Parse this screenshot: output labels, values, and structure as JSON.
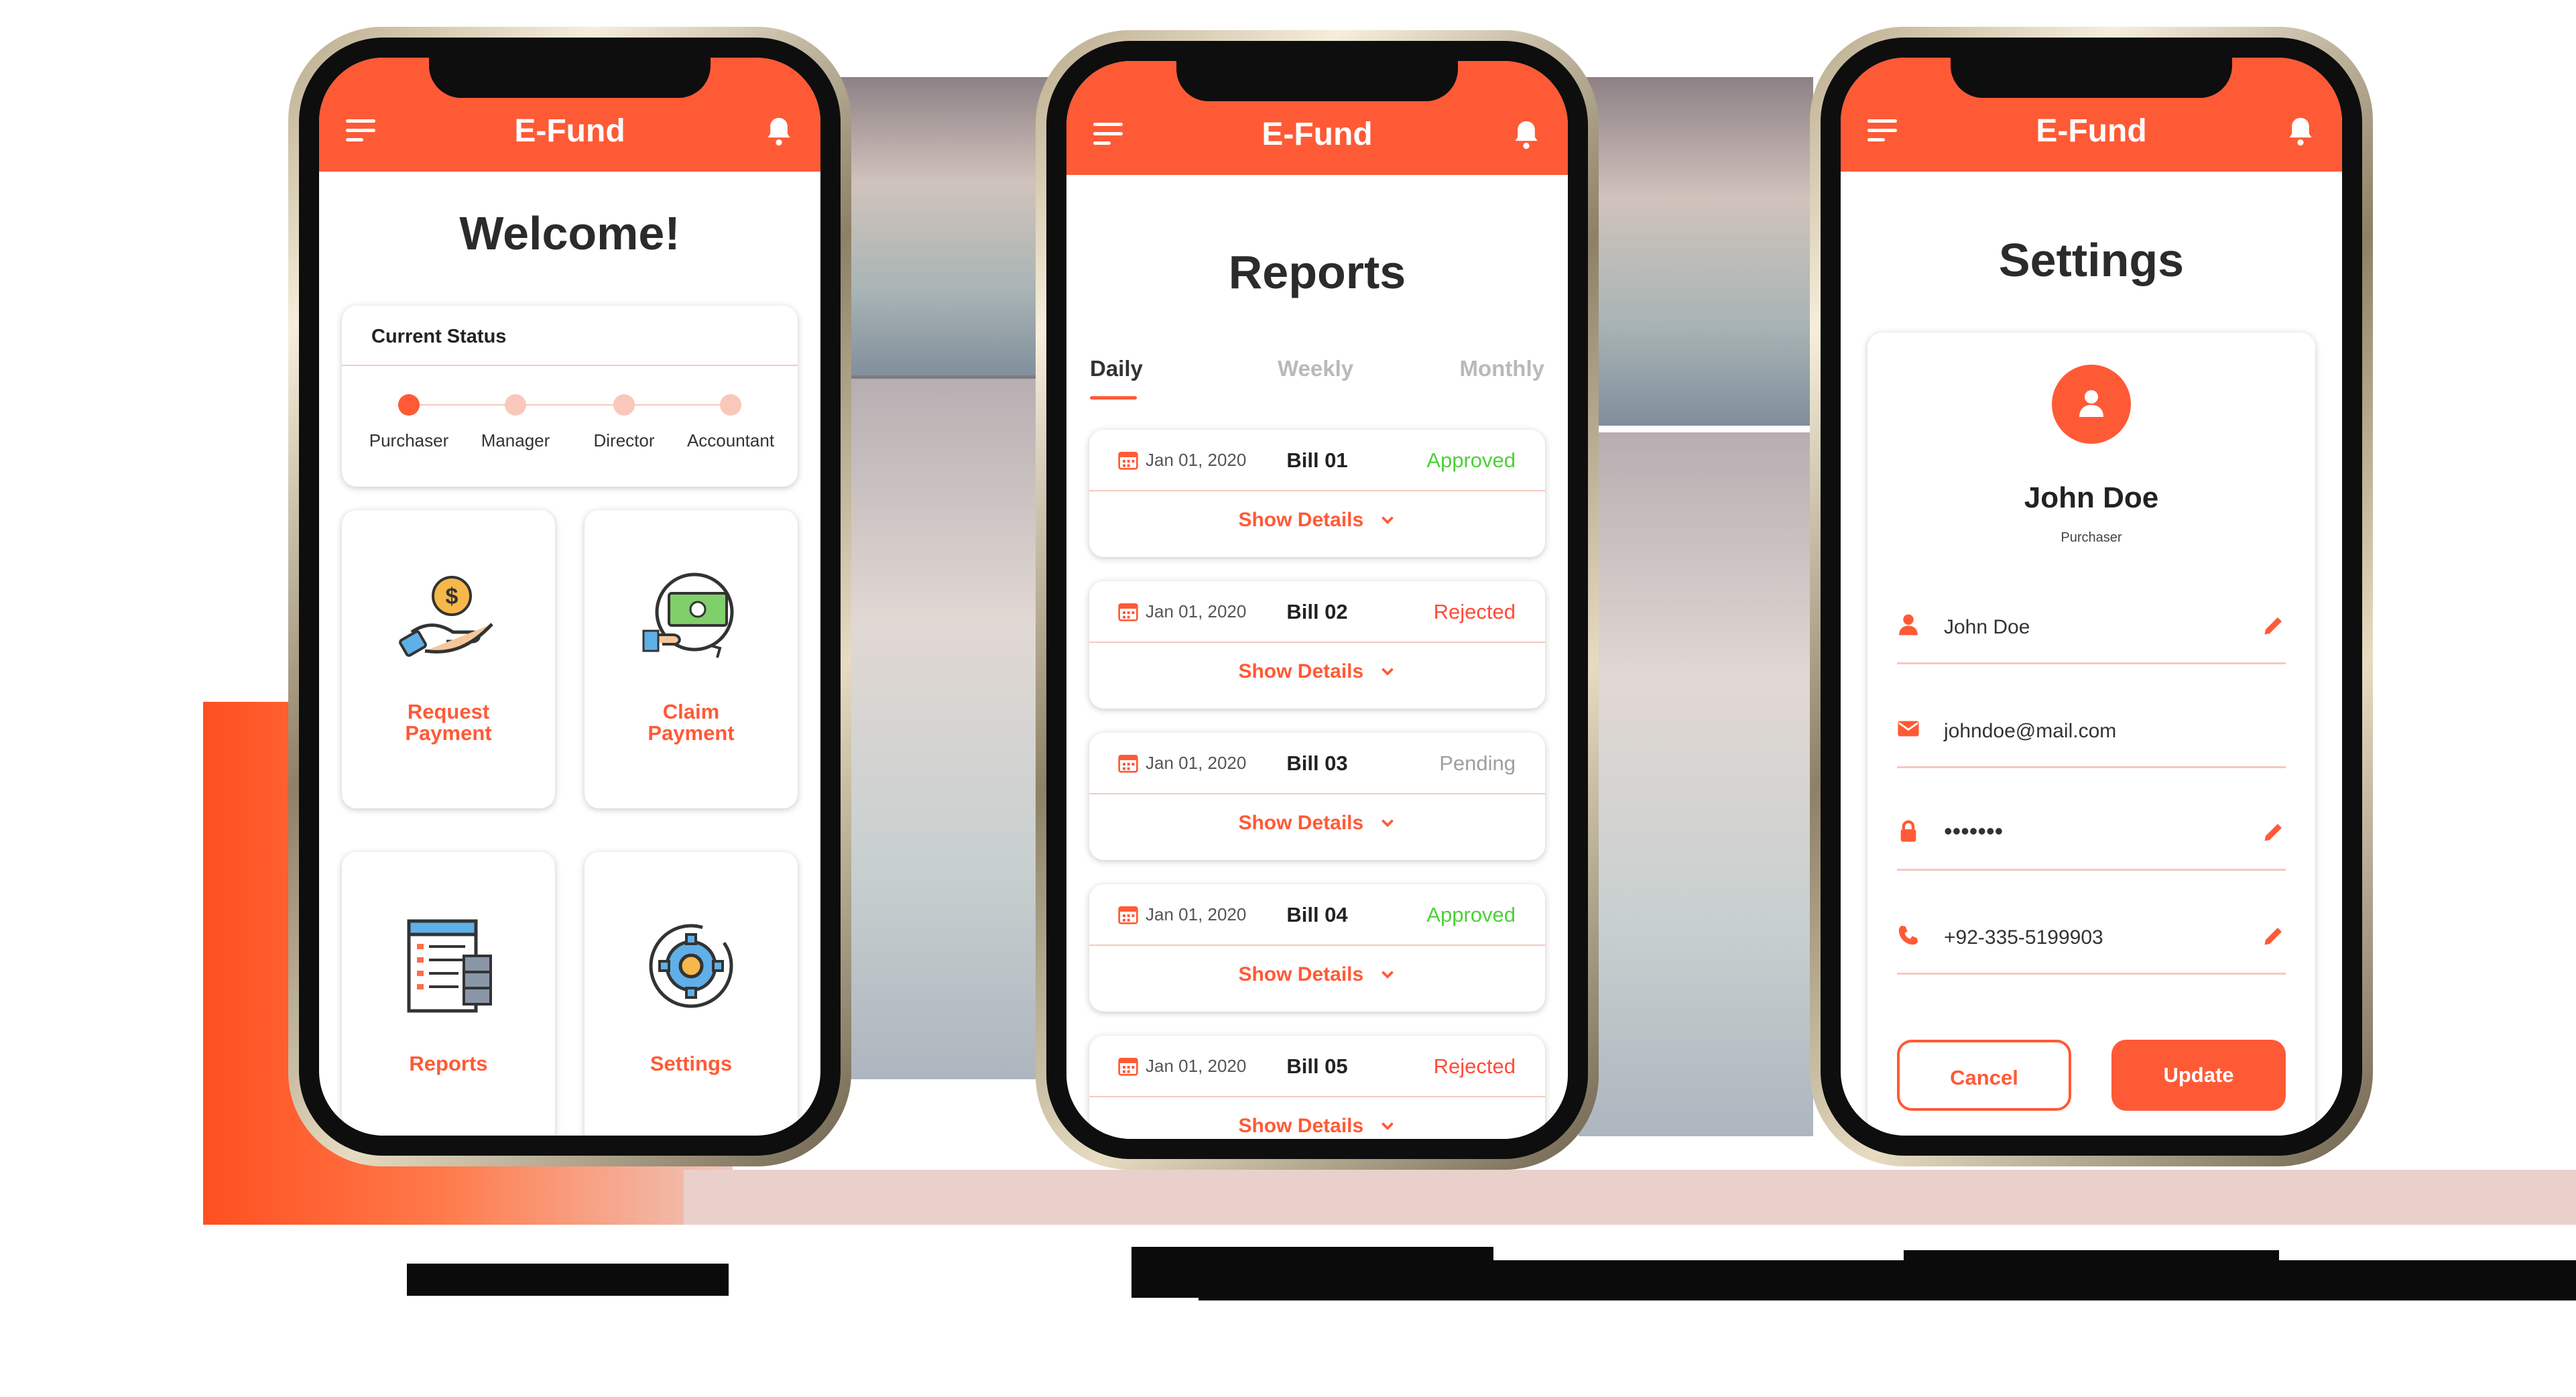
{
  "app": {
    "name": "E-Fund"
  },
  "colors": {
    "accent": "#ff5a36",
    "approved": "#4cd137",
    "rejected": "#ff4b3a",
    "pending": "#9e9e9e"
  },
  "home": {
    "heading": "Welcome!",
    "status": {
      "title": "Current Status",
      "steps": [
        "Purchaser",
        "Manager",
        "Director",
        "Accountant"
      ],
      "active_step": "Purchaser"
    },
    "tiles": [
      {
        "line1": "Request",
        "line2": "Payment",
        "icon": "request-payment-icon"
      },
      {
        "line1": "Claim",
        "line2": "Payment",
        "icon": "claim-payment-icon"
      },
      {
        "line1": "Reports",
        "icon": "reports-icon"
      },
      {
        "line1": "Settings",
        "icon": "settings-icon"
      }
    ]
  },
  "reports": {
    "heading": "Reports",
    "tabs": [
      "Daily",
      "Weekly",
      "Monthly"
    ],
    "active_tab": "Daily",
    "show_details_label": "Show Details",
    "bills": [
      {
        "date": "Jan 01, 2020",
        "name": "Bill 01",
        "status": "Approved"
      },
      {
        "date": "Jan 01, 2020",
        "name": "Bill 02",
        "status": "Rejected"
      },
      {
        "date": "Jan 01, 2020",
        "name": "Bill 03",
        "status": "Pending"
      },
      {
        "date": "Jan 01, 2020",
        "name": "Bill 04",
        "status": "Approved"
      },
      {
        "date": "Jan 01, 2020",
        "name": "Bill 05",
        "status": "Rejected"
      }
    ]
  },
  "settings": {
    "heading": "Settings",
    "profile": {
      "name": "John Doe",
      "role": "Purchaser"
    },
    "fields": [
      {
        "icon": "user-icon",
        "value": "John Doe",
        "editable": true
      },
      {
        "icon": "mail-icon",
        "value": "johndoe@mail.com",
        "editable": false
      },
      {
        "icon": "lock-icon",
        "value": "•••••••",
        "editable": true
      },
      {
        "icon": "phone-icon",
        "value": "+92-335-5199903",
        "editable": true
      }
    ],
    "cancel_label": "Cancel",
    "update_label": "Update"
  }
}
